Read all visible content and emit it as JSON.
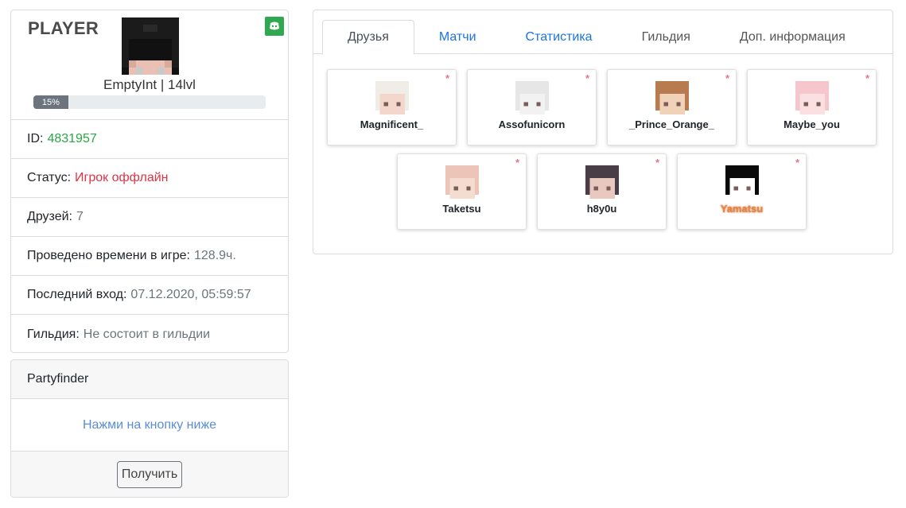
{
  "profile": {
    "title": "PLAYER",
    "discord_icon": "discord-icon",
    "name_level": "EmptyInt | 14lvl",
    "progress_label": "15%",
    "progress_fraction": 0.15,
    "rows": [
      {
        "label": "ID:",
        "value": "4831957",
        "tone": "green"
      },
      {
        "label": "Статус:",
        "value": "Игрок оффлайн",
        "tone": "red"
      },
      {
        "label": "Друзей:",
        "value": "7",
        "tone": "gray"
      },
      {
        "label": "Проведено времени в игре:",
        "value": "128.9ч.",
        "tone": "gray"
      },
      {
        "label": "Последний вход:",
        "value": "07.12.2020, 05:59:57",
        "tone": "gray"
      },
      {
        "label": "Гильдия:",
        "value": "Не состоит в гильдии",
        "tone": "gray"
      }
    ]
  },
  "partyfinder": {
    "title": "Partyfinder",
    "hint": "Нажми на кнопку ниже",
    "button": "Получить"
  },
  "tabs": [
    {
      "label": "Друзья",
      "active": true
    },
    {
      "label": "Матчи",
      "active": false
    },
    {
      "label": "Статистика",
      "active": false
    },
    {
      "label": "Гильдия",
      "active": false
    },
    {
      "label": "Доп. информация",
      "active": false
    }
  ],
  "friends": [
    {
      "name": "Magnificent_",
      "mark": "*",
      "hair": "#f0ece6",
      "skin": "#f3d6cc"
    },
    {
      "name": "Assofunicorn",
      "mark": "*",
      "hair": "#e6e6e6",
      "skin": "#f2f2f2"
    },
    {
      "name": "_Prince_Orange_",
      "mark": "*",
      "hair": "#b87a4f",
      "skin": "#f0d2b8"
    },
    {
      "name": "Maybe_you",
      "mark": "*",
      "hair": "#f5c6cb",
      "skin": "#fae0e0"
    },
    {
      "name": "Taketsu",
      "mark": "*",
      "hair": "#ecc4b8",
      "skin": "#f5dcd0"
    },
    {
      "name": "h8y0u",
      "mark": "*",
      "hair": "#4a3e46",
      "skin": "#e9c8c0"
    },
    {
      "name": "Yamatsu",
      "mark": "*",
      "hair": "#0a0a0a",
      "skin": "#ffffff",
      "special": true
    }
  ],
  "colors": {
    "accent_link": "#1a73e8",
    "status_green": "#28a745",
    "status_red": "#dc3545",
    "muted": "#6c757d"
  }
}
